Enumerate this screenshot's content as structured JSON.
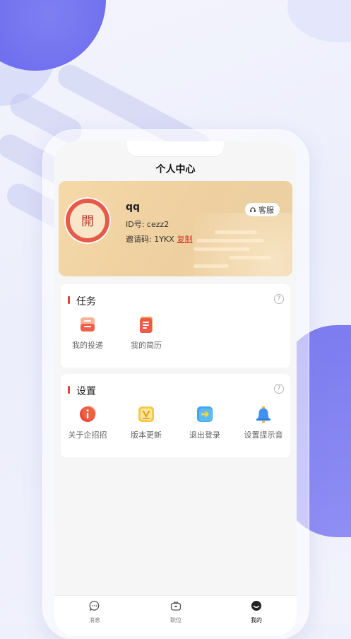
{
  "header": {
    "title": "个人中心"
  },
  "profile": {
    "avatar_text": "開",
    "name": "qq",
    "id_text": "ID号: cezz2",
    "invite_label": "邀请码: 1YKX",
    "copy_label": "复制",
    "service_label": "客服"
  },
  "tasks": {
    "title": "任务",
    "items": [
      {
        "label": "我的投递",
        "icon": "delivery-icon"
      },
      {
        "label": "我的简历",
        "icon": "resume-icon"
      }
    ]
  },
  "settings": {
    "title": "设置",
    "items": [
      {
        "label": "关于企招招",
        "icon": "info-icon"
      },
      {
        "label": "版本更新",
        "icon": "version-update-icon"
      },
      {
        "label": "退出登录",
        "icon": "logout-icon"
      },
      {
        "label": "设置提示音",
        "icon": "bell-icon"
      }
    ]
  },
  "tabbar": {
    "items": [
      {
        "label": "消息",
        "icon": "message-icon"
      },
      {
        "label": "职位",
        "icon": "briefcase-icon"
      },
      {
        "label": "我的",
        "icon": "profile-icon",
        "active": true
      }
    ]
  },
  "colors": {
    "accent": "#e0453a",
    "card": "#efd0a0",
    "purple": "#6d6cee"
  }
}
